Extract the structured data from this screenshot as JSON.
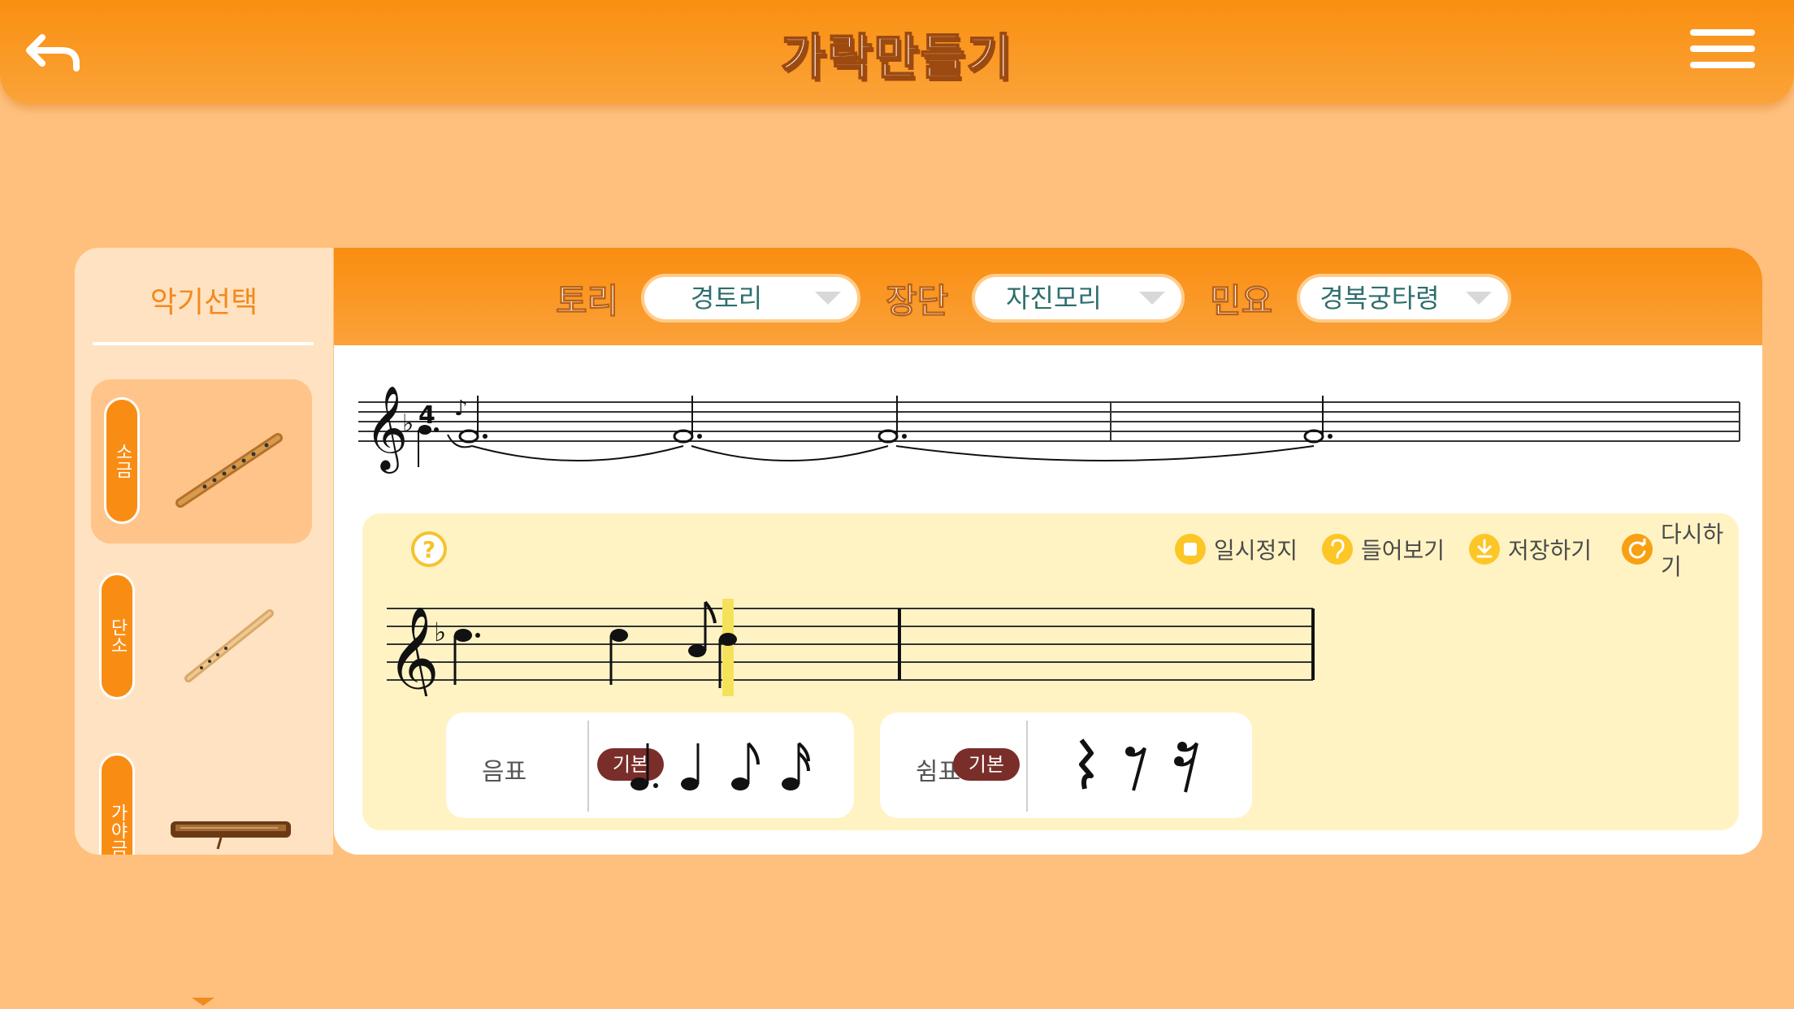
{
  "header": {
    "title": "가락만들기",
    "back_icon": "back-arrow-icon",
    "menu_icon": "hamburger-menu-icon"
  },
  "instrument_panel": {
    "title": "악기선택",
    "items": [
      {
        "label": "소금",
        "icon": "sogeum-flute-icon",
        "selected": true
      },
      {
        "label": "단소",
        "icon": "danso-flute-icon",
        "selected": false
      },
      {
        "label": "가야금",
        "icon": "gayageum-icon",
        "selected": false
      }
    ]
  },
  "selectors": {
    "tori": {
      "label": "토리",
      "value": "경토리"
    },
    "jangdan": {
      "label": "장단",
      "value": "자진모리"
    },
    "minyo": {
      "label": "민요",
      "value": "경복궁타령"
    }
  },
  "controls": {
    "pause": "일시정지",
    "listen": "들어보기",
    "save": "저장하기",
    "reset": "다시하기"
  },
  "palettes": {
    "notes": {
      "label": "음표",
      "badge": "기본",
      "symbols": [
        "dotted-quarter-note",
        "quarter-note",
        "eighth-note",
        "sixteenth-note"
      ]
    },
    "rests": {
      "label": "쉼표",
      "badge": "기본",
      "symbols": [
        "quarter-rest",
        "eighth-rest",
        "sixteenth-rest"
      ]
    }
  },
  "colors": {
    "header_orange": "#f98f10",
    "background": "#ffc07e",
    "badge": "#7a2e2a",
    "composer_bg": "#fff3c4"
  }
}
